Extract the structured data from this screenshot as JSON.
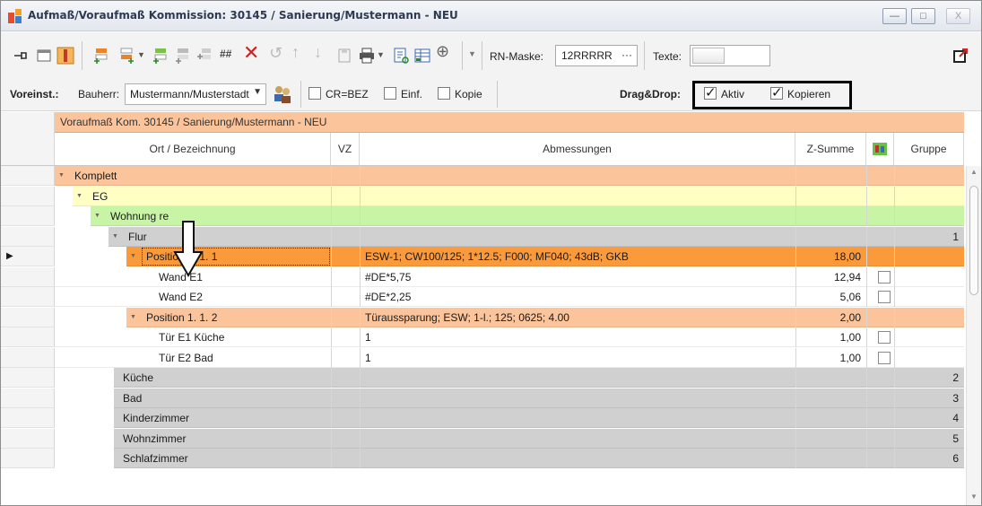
{
  "window": {
    "title": "Aufmaß/Voraufmaß Kommission: 30145 / Sanierung/Mustermann - NEU",
    "buttons": {
      "minimize": "—",
      "maximize": "□",
      "close": "X"
    }
  },
  "toolbar": {
    "rn_mask_label": "RN-Maske:",
    "rn_mask_value": "12RRRRR",
    "rn_mask_more": "···",
    "texte_label": "Texte:",
    "hash_label": "##"
  },
  "toolbar2": {
    "voreinst_label": "Voreinst.:",
    "bauherr_label": "Bauherr:",
    "bauherr_value": "Mustermann/Musterstadt",
    "cr_bez_label": "CR=BEZ",
    "einf_label": "Einf.",
    "kopie_label": "Kopie",
    "dragdrop_label": "Drag&Drop:",
    "aktiv_label": "Aktiv",
    "kopieren_label": "Kopieren",
    "aktiv_checked": true,
    "kopieren_checked": true
  },
  "grid": {
    "group_header": "Voraufmaß Kom. 30145 / Sanierung/Mustermann - NEU",
    "columns": {
      "ort": "Ort / Bezeichnung",
      "vz": "VZ",
      "abmessungen": "Abmessungen",
      "zsumme": "Z-Summe",
      "gruppe": "Gruppe"
    },
    "rows": [
      {
        "label": "Komplett",
        "abm": "",
        "zsumme": "",
        "gruppe": ""
      },
      {
        "label": "EG",
        "abm": "",
        "zsumme": "",
        "gruppe": ""
      },
      {
        "label": "Wohnung re",
        "abm": "",
        "zsumme": "",
        "gruppe": ""
      },
      {
        "label": "Flur",
        "abm": "",
        "zsumme": "",
        "gruppe": "1"
      },
      {
        "label": "Position  1.  1.   1",
        "abm": "ESW-1; CW100/125; 1*12.5; F000; MF040; 43dB; GKB",
        "zsumme": "18,00",
        "gruppe": ""
      },
      {
        "label": "Wand E1",
        "abm": "#DE*5,75",
        "zsumme": "12,94",
        "gruppe": ""
      },
      {
        "label": "Wand E2",
        "abm": "#DE*2,25",
        "zsumme": "5,06",
        "gruppe": ""
      },
      {
        "label": "Position  1.  1.   2",
        "abm": "Türaussparung; ESW; 1-l.; 125; 0625; 4.00",
        "zsumme": "2,00",
        "gruppe": ""
      },
      {
        "label": "Tür E1 Küche",
        "abm": "1",
        "zsumme": "1,00",
        "gruppe": ""
      },
      {
        "label": "Tür E2 Bad",
        "abm": "1",
        "zsumme": "1,00",
        "gruppe": ""
      },
      {
        "label": "Küche",
        "abm": "",
        "zsumme": "",
        "gruppe": "2"
      },
      {
        "label": "Bad",
        "abm": "",
        "zsumme": "",
        "gruppe": "3"
      },
      {
        "label": "Kinderzimmer",
        "abm": "",
        "zsumme": "",
        "gruppe": "4"
      },
      {
        "label": "Wohnzimmer",
        "abm": "",
        "zsumme": "",
        "gruppe": "5"
      },
      {
        "label": "Schlafzimmer",
        "abm": "",
        "zsumme": "",
        "gruppe": "6"
      }
    ]
  },
  "colors": {
    "komplett": "#fbc49a",
    "eg": "#ffffc4",
    "wohnung": "#c8f5a5",
    "room": "#d0d0d0",
    "position_selected": "#fb9a3a",
    "position": "#fbc49a"
  }
}
